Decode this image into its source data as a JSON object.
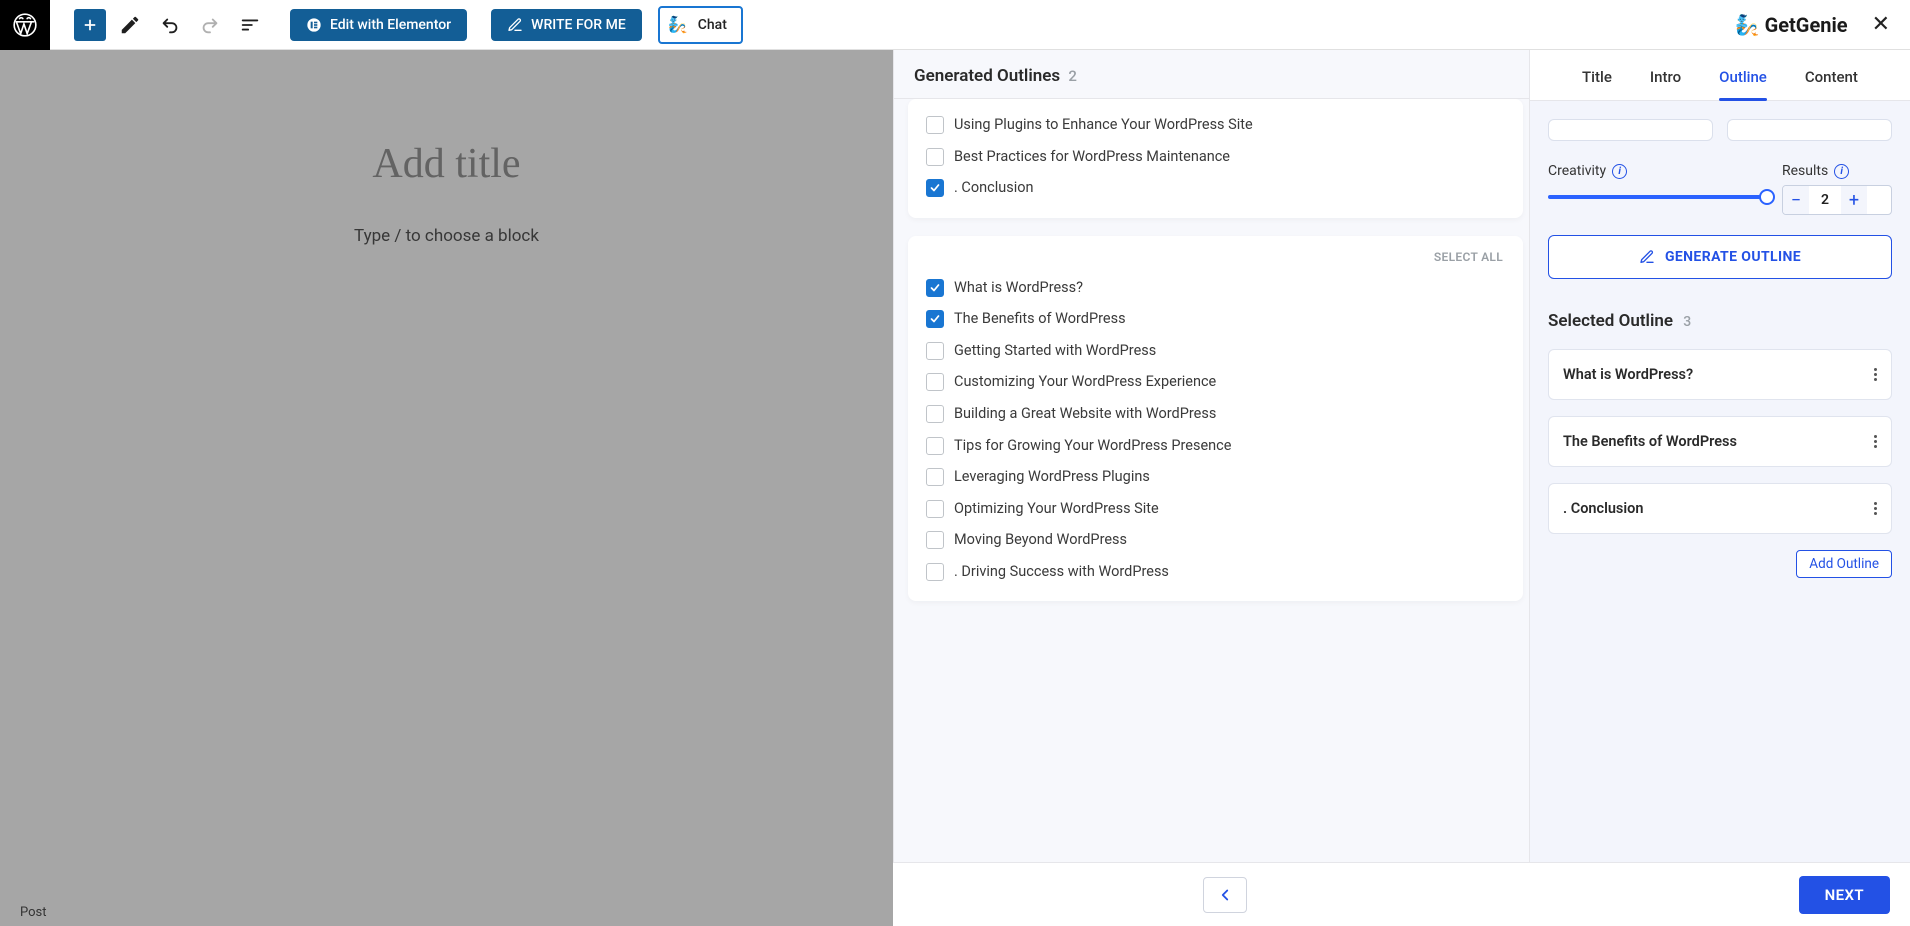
{
  "toolbar": {
    "elementor_label": "Edit with Elementor",
    "write_label": "WRITE FOR ME",
    "chat_label": "Chat"
  },
  "brand": "GetGenie",
  "editor": {
    "title_placeholder": "Add title",
    "block_prompt": "Type / to choose a block",
    "status": "Post"
  },
  "mid": {
    "header": "Generated Outlines",
    "count": "2",
    "select_all": "SELECT ALL",
    "group1": [
      {
        "label": "Using Plugins to Enhance Your WordPress Site",
        "checked": false
      },
      {
        "label": "Best Practices for WordPress Maintenance",
        "checked": false
      },
      {
        "label": ". Conclusion",
        "checked": true
      }
    ],
    "group2": [
      {
        "label": "What is WordPress?",
        "checked": true
      },
      {
        "label": "The Benefits of WordPress",
        "checked": true
      },
      {
        "label": "Getting Started with WordPress",
        "checked": false
      },
      {
        "label": "Customizing Your WordPress Experience",
        "checked": false
      },
      {
        "label": "Building a Great Website with WordPress",
        "checked": false
      },
      {
        "label": "Tips for Growing Your WordPress Presence",
        "checked": false
      },
      {
        "label": "Leveraging WordPress Plugins",
        "checked": false
      },
      {
        "label": "Optimizing Your WordPress Site",
        "checked": false
      },
      {
        "label": "Moving Beyond WordPress",
        "checked": false
      },
      {
        "label": ". Driving Success with WordPress",
        "checked": false
      }
    ]
  },
  "tabs": [
    "Title",
    "Intro",
    "Outline",
    "Content"
  ],
  "controls": {
    "creativity_label": "Creativity",
    "results_label": "Results",
    "results_value": "2",
    "generate_label": "GENERATE OUTLINE"
  },
  "selected": {
    "header": "Selected Outline",
    "count": "3",
    "items": [
      "What is WordPress?",
      "The Benefits of WordPress",
      ". Conclusion"
    ],
    "add_label": "Add Outline"
  },
  "footer": {
    "next": "NEXT"
  }
}
